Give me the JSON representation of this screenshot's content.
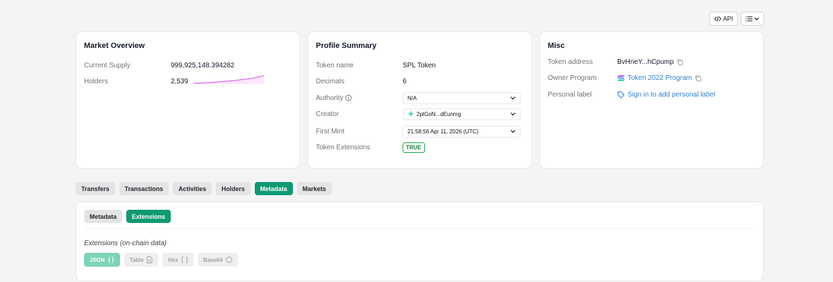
{
  "toolbar": {
    "api_label": "API"
  },
  "market": {
    "title": "Market Overview",
    "supply_label": "Current Supply",
    "supply_value": "999,925,148.394282",
    "holders_label": "Holders",
    "holders_value": "2,539"
  },
  "profile": {
    "title": "Profile Summary",
    "token_name_label": "Token name",
    "token_name_value": "SPL Token",
    "decimals_label": "Decimals",
    "decimals_value": "6",
    "authority_label": "Authority",
    "authority_value": "N/A",
    "creator_label": "Creator",
    "creator_value": "2ptGoN...dEunmg",
    "first_mint_label": "First Mint",
    "first_mint_value": "21:58:56 Apr 11, 2026 (UTC)",
    "extensions_label": "Token Extensions",
    "extensions_value": "TRUE"
  },
  "misc": {
    "title": "Misc",
    "address_label": "Token address",
    "address_value": "BvHneY...hCpump",
    "owner_label": "Owner Program",
    "owner_value": "Token 2022 Program",
    "personal_label": "Personal label",
    "personal_value": "Sign in to add personal label"
  },
  "tabs": [
    "Transfers",
    "Transactions",
    "Activities",
    "Holders",
    "Metadata",
    "Markets"
  ],
  "active_tab": "Metadata",
  "subtabs": [
    "Metadata",
    "Extensions"
  ],
  "active_subtab": "Extensions",
  "extensions_heading": "Extensions (on-chain data)",
  "formats": {
    "json": "JSON",
    "table": "Table",
    "hex": "Hex",
    "base64": "Base64"
  },
  "colors": {
    "accent": "#0f9a73",
    "link": "#2f80d0",
    "sparkline": "#d946ef"
  }
}
